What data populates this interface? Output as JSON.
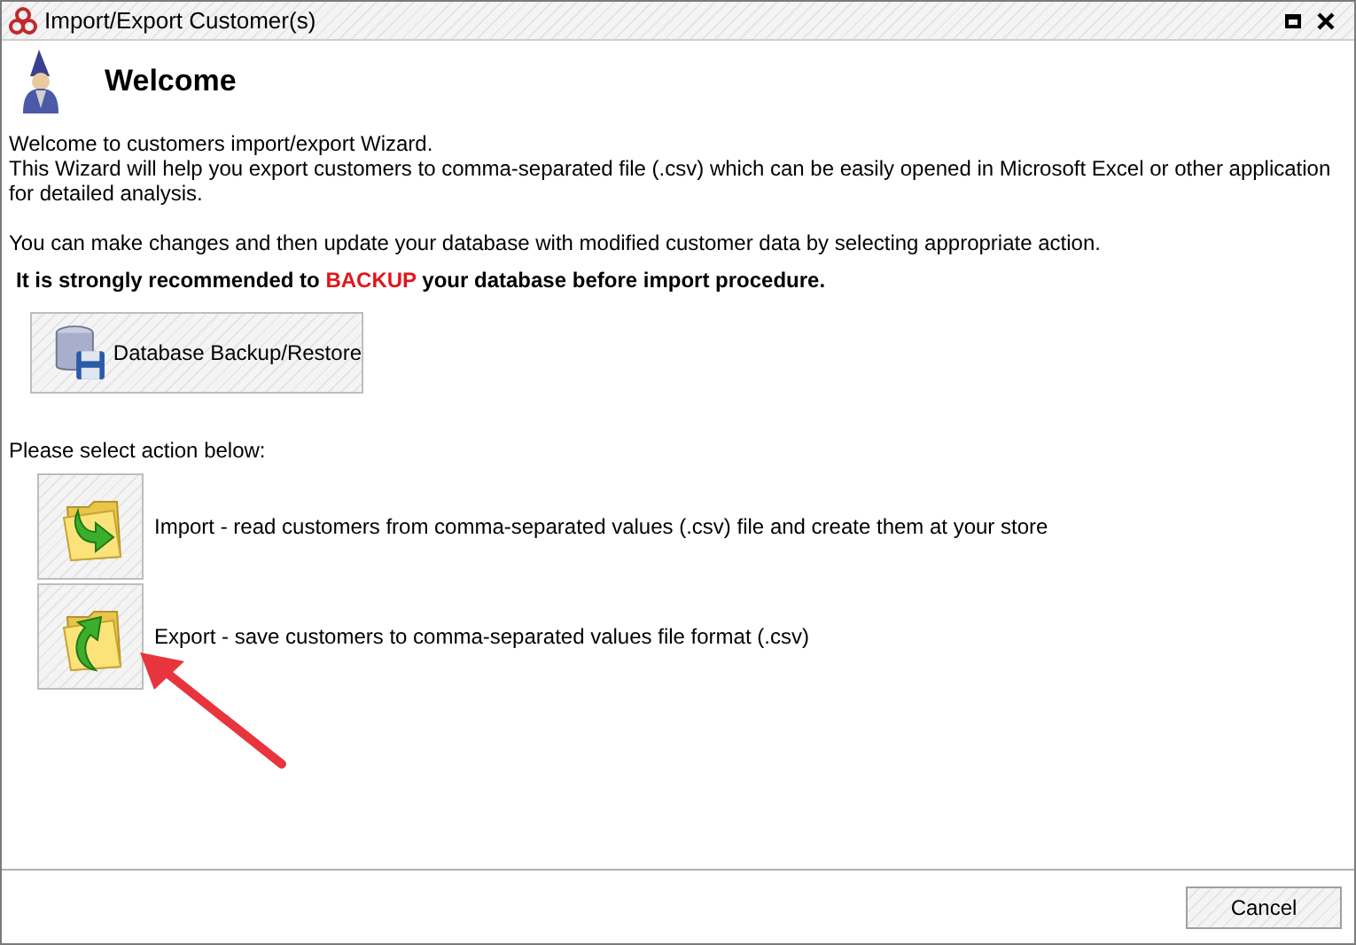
{
  "window": {
    "title": "Import/Export Customer(s)"
  },
  "heading": "Welcome",
  "intro": [
    "Welcome to customers import/export Wizard.",
    "This Wizard will help you export customers to comma-separated file (.csv) which can be easily opened in Microsoft Excel or other application for detailed analysis."
  ],
  "note": "You can make changes and then update your database with modified customer data by selecting appropriate action.",
  "warning": [
    {
      "text": "It is strongly recommended to ",
      "emphasis": false
    },
    {
      "text": "BACKUP",
      "emphasis": true
    },
    {
      "text": " your database before import procedure.",
      "emphasis": false
    }
  ],
  "backup_button": "Database Backup/Restore",
  "prompt": "Please select action below:",
  "actions": [
    {
      "kind": "import",
      "label": "Import - read customers from comma-separated values (.csv) file and create them at your store"
    },
    {
      "kind": "export",
      "label": "Export - save customers to comma-separated values file format (.csv)"
    }
  ],
  "cancel_button": "Cancel"
}
